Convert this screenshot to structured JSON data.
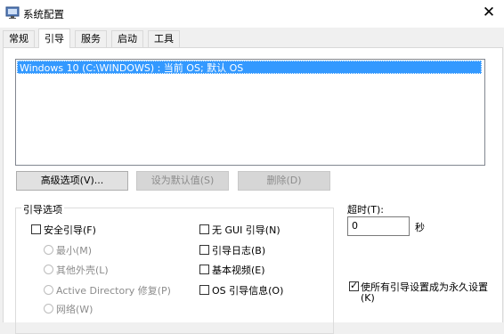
{
  "window": {
    "title": "系统配置",
    "close_glyph": "✕"
  },
  "tabs": [
    {
      "label": "常规"
    },
    {
      "label": "引导"
    },
    {
      "label": "服务"
    },
    {
      "label": "启动"
    },
    {
      "label": "工具"
    }
  ],
  "active_tab": "引导",
  "boot_list": {
    "entries": [
      "Windows 10 (C:\\WINDOWS) : 当前 OS; 默认 OS"
    ],
    "selected_index": 0
  },
  "buttons": {
    "advanced": "高级选项(V)...",
    "set_default": "设为默认值(S)",
    "delete": "删除(D)"
  },
  "boot_options": {
    "title": "引导选项",
    "safe_boot": {
      "label": "安全引导(F)",
      "checked": false
    },
    "radios": [
      {
        "label": "最小(M)"
      },
      {
        "label": "其他外壳(L)"
      },
      {
        "label": "Active Directory 修复(P)"
      },
      {
        "label": "网络(W)"
      }
    ],
    "checks": [
      {
        "label": "无 GUI 引导(N)",
        "checked": false
      },
      {
        "label": "引导日志(B)",
        "checked": false
      },
      {
        "label": "基本视频(E)",
        "checked": false
      },
      {
        "label": "OS 引导信息(O)",
        "checked": false
      }
    ]
  },
  "timeout": {
    "label": "超时(T):",
    "value": "0",
    "unit": "秒"
  },
  "permanent": {
    "label_line1": "使所有引导设置成为永久设置",
    "label_line2": "(K)",
    "checked": true
  },
  "colors": {
    "selection": "#3399ff",
    "panel": "#ffffff",
    "chrome": "#f0f0f0"
  }
}
